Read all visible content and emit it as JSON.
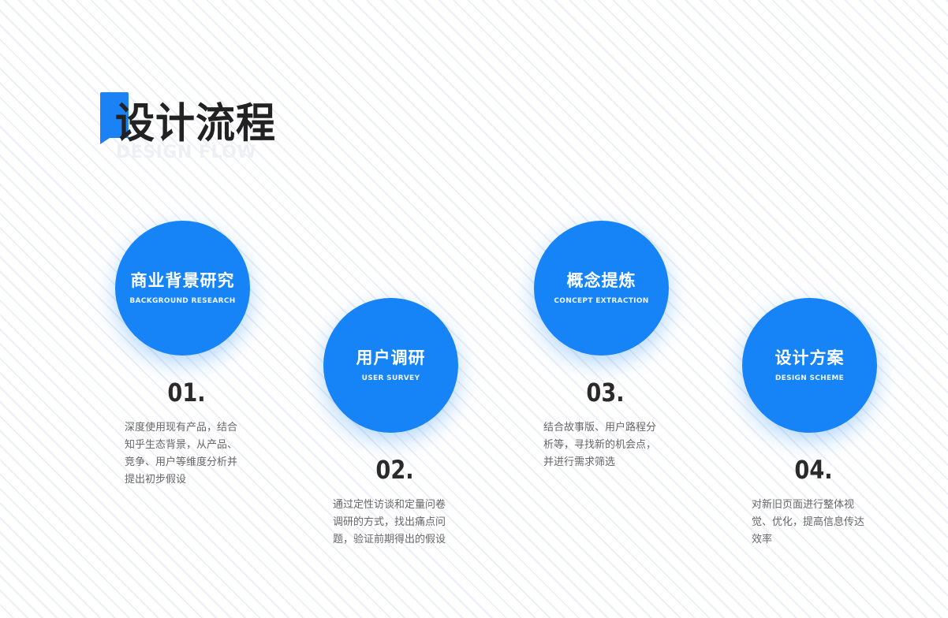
{
  "header": {
    "title": "设计流程",
    "subtitle": "DESIGN FLOW"
  },
  "steps": [
    {
      "title": "商业背景研究",
      "title_en": "BACKGROUND RESEARCH",
      "number": "01.",
      "description": "深度使用现有产品，结合知乎生态背景，从产品、竞争、用户等维度分析并提出初步假设"
    },
    {
      "title": "用户调研",
      "title_en": "USER SURVEY",
      "number": "02.",
      "description": "通过定性访谈和定量问卷调研的方式，找出痛点问题，验证前期得出的假设"
    },
    {
      "title": "概念提炼",
      "title_en": "CONCEPT EXTRACTION",
      "number": "03.",
      "description": "结合故事版、用户路程分析等，寻找新的机会点，并进行需求筛选"
    },
    {
      "title": "设计方案",
      "title_en": "DESIGN SCHEME",
      "number": "04.",
      "description": "对新旧页面进行整体视觉、优化，提高信息传达效率"
    }
  ],
  "colors": {
    "accent": "#1683f6",
    "title": "#222222",
    "text": "#666666"
  }
}
